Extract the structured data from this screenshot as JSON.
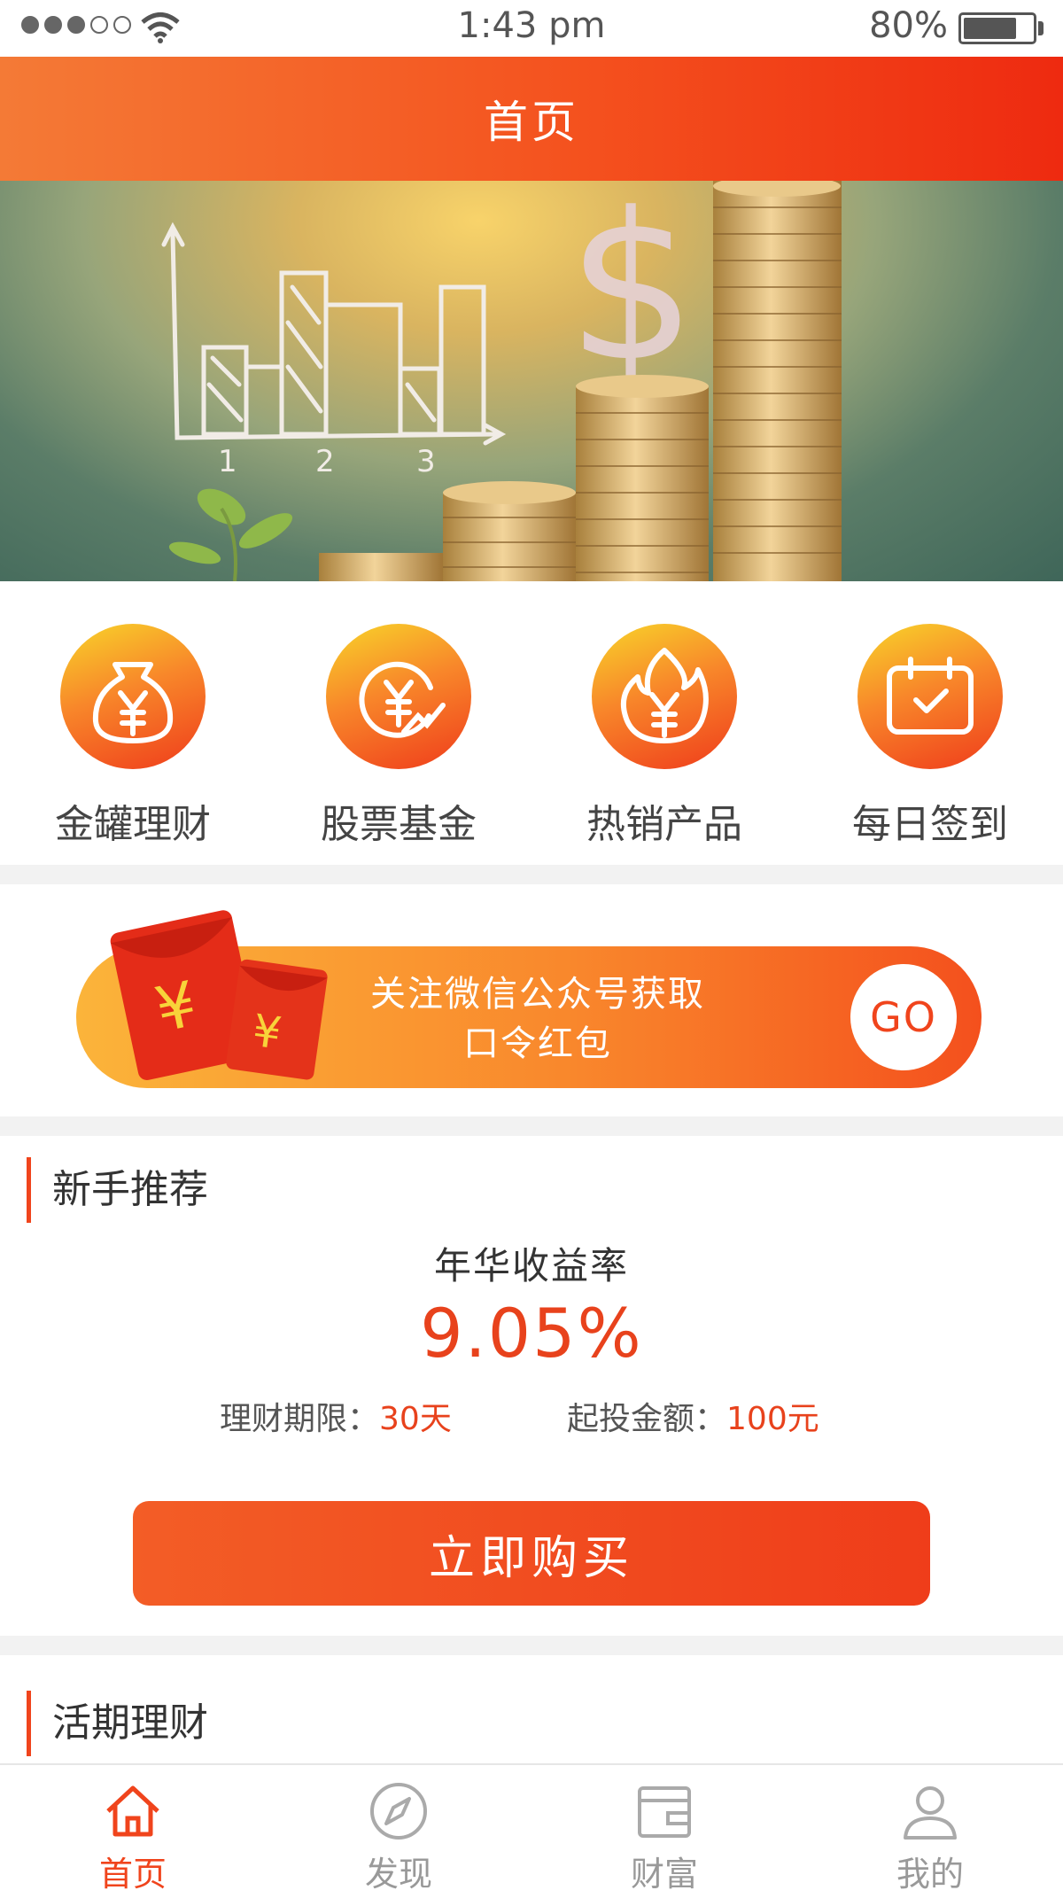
{
  "status_bar": {
    "time": "1:43 pm",
    "battery": "80%"
  },
  "header": {
    "title": "首页"
  },
  "features": [
    {
      "label": "金罐理财",
      "icon": "money-bag-icon"
    },
    {
      "label": "股票基金",
      "icon": "stock-fund-icon"
    },
    {
      "label": "热销产品",
      "icon": "hot-product-icon"
    },
    {
      "label": "每日签到",
      "icon": "calendar-check-icon"
    }
  ],
  "promo": {
    "line1": "关注微信公众号获取",
    "line2": "口令红包",
    "go": "GO"
  },
  "newbie": {
    "title": "新手推荐",
    "rate_label": "年华收益率",
    "rate": "9.05%",
    "term_label": "理财期限：",
    "term_value": "30天",
    "min_label": "起投金额：",
    "min_value": "100元",
    "buy": "立即购买"
  },
  "current": {
    "title": "活期理财"
  },
  "tabs": [
    {
      "label": "首页",
      "icon": "home-icon",
      "active": true
    },
    {
      "label": "发现",
      "icon": "compass-icon",
      "active": false
    },
    {
      "label": "财富",
      "icon": "wallet-icon",
      "active": false
    },
    {
      "label": "我的",
      "icon": "user-icon",
      "active": false
    }
  ],
  "colors": {
    "accent": "#f0441c",
    "header_start": "#f47a36",
    "header_end": "#ee2a10"
  }
}
